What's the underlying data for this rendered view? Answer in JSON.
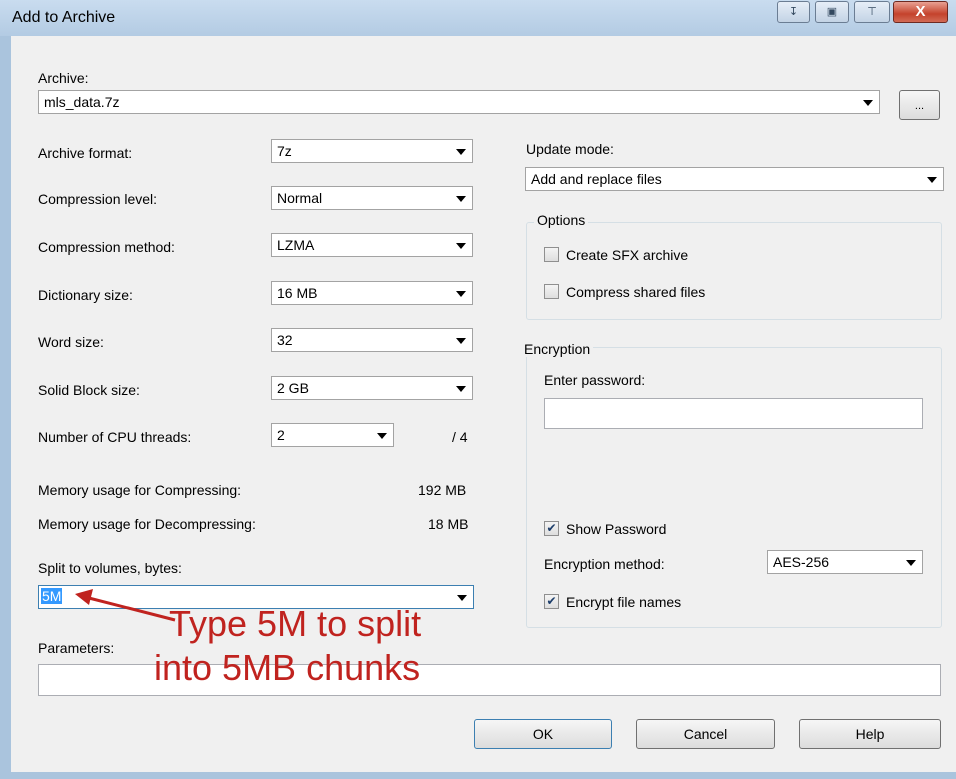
{
  "window": {
    "title": "Add to Archive"
  },
  "archive": {
    "label": "Archive:",
    "value": "mls_data.7z",
    "browse_label": "..."
  },
  "settings": [
    {
      "label": "Archive format:",
      "value": "7z"
    },
    {
      "label": "Compression level:",
      "value": "Normal"
    },
    {
      "label": "Compression method:",
      "value": "LZMA"
    },
    {
      "label": "Dictionary size:",
      "value": "16 MB"
    },
    {
      "label": "Word size:",
      "value": "32"
    },
    {
      "label": "Solid Block size:",
      "value": "2 GB"
    }
  ],
  "threads": {
    "label": "Number of CPU threads:",
    "value": "2",
    "max": "/ 4"
  },
  "memory": {
    "compress_label": "Memory usage for Compressing:",
    "compress_value": "192 MB",
    "decompress_label": "Memory usage for Decompressing:",
    "decompress_value": "18 MB"
  },
  "split": {
    "label": "Split to volumes, bytes:",
    "value": "5M"
  },
  "parameters": {
    "label": "Parameters:",
    "value": ""
  },
  "update": {
    "label": "Update mode:",
    "value": "Add and replace files"
  },
  "options": {
    "label": "Options",
    "sfx_label": "Create SFX archive",
    "shared_label": "Compress shared files"
  },
  "encryption": {
    "label": "Encryption",
    "password_label": "Enter password:",
    "show_password_label": "Show Password",
    "method_label": "Encryption method:",
    "method_value": "AES-256",
    "encrypt_names_label": "Encrypt file names"
  },
  "buttons": {
    "ok": "OK",
    "cancel": "Cancel",
    "help": "Help"
  },
  "annotation": {
    "line1": "Type 5M to split",
    "line2": "into 5MB chunks"
  },
  "colors": {
    "annotation": "#c0231f",
    "selection": "#3399ff"
  }
}
